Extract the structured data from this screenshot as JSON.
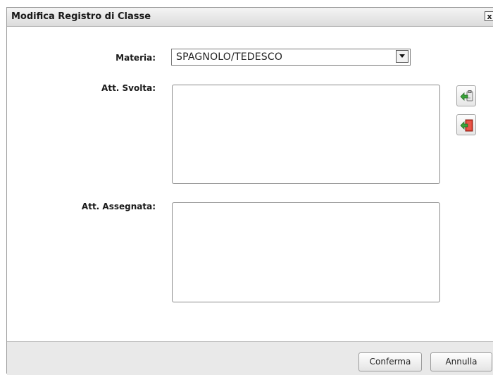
{
  "dialog": {
    "title": "Modifica Registro di Classe",
    "close_glyph": "x"
  },
  "form": {
    "materia_label": "Materia:",
    "materia_value": "SPAGNOLO/TEDESCO",
    "att_svolta_label": "Att. Svolta:",
    "att_svolta_value": "",
    "att_assegnata_label": "Att. Assegnata:",
    "att_assegnata_value": ""
  },
  "side_buttons": {
    "copy_icon": "paste-green-arrow-icon",
    "import_icon": "red-book-green-arrow-icon"
  },
  "footer": {
    "confirm_label": "Conferma",
    "cancel_label": "Annulla"
  },
  "colors": {
    "arrow_green": "#3aa33a",
    "book_red": "#d83a2a"
  }
}
